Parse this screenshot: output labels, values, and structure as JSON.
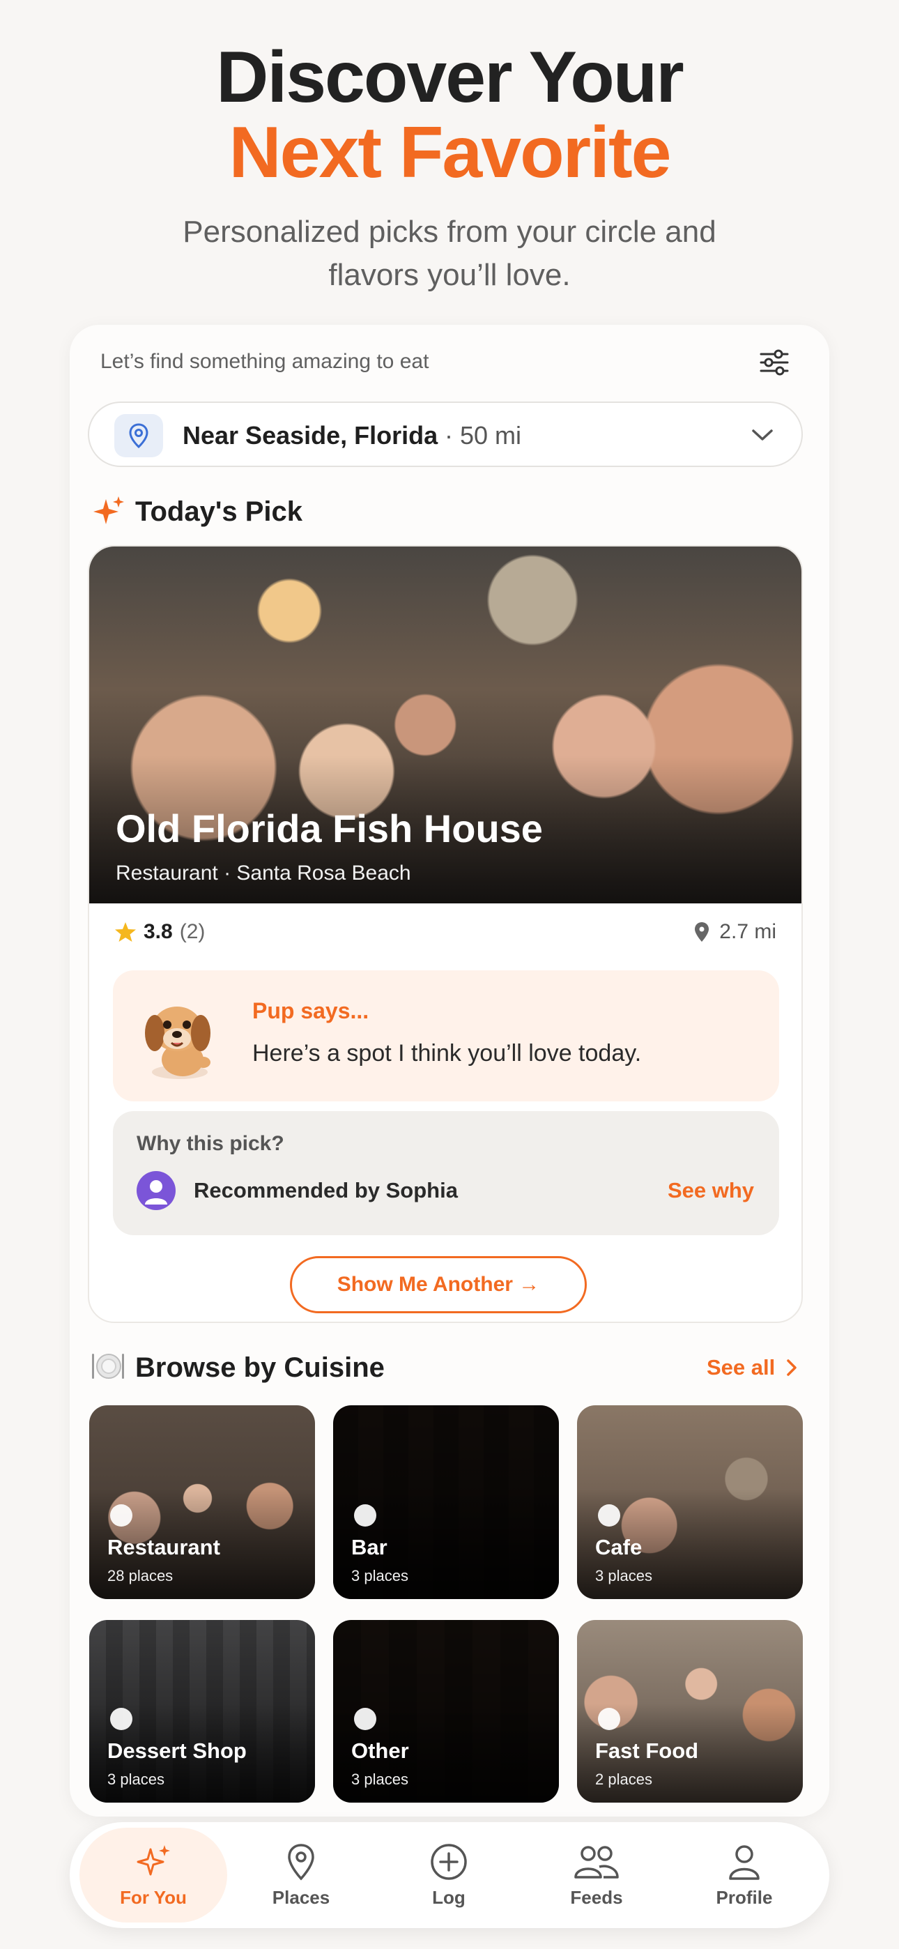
{
  "hero": {
    "title_line1": "Discover Your",
    "title_line2": "Next Favorite",
    "subtitle": "Personalized picks from your circle and flavors you’ll love."
  },
  "finder": {
    "prompt": "Let’s find something amazing to eat",
    "filter_icon": "sliders-icon"
  },
  "location": {
    "name": "Near Seaside, Florida",
    "distance": "· 50 mi",
    "icon": "map-pin-icon"
  },
  "todays_pick": {
    "section_title": "Today's Pick",
    "name": "Old Florida Fish House",
    "meta": "Restaurant · Santa Rosa Beach",
    "rating": "3.8",
    "rating_count": "(2)",
    "distance": "2.7 mi",
    "pup_title": "Pup says...",
    "pup_message": "Here’s a spot I think you’ll love today.",
    "why_title": "Why this pick?",
    "recommended_by": "Recommended by Sophia",
    "see_why": "See why",
    "another_button": "Show Me Another →"
  },
  "browse": {
    "section_title": "Browse by Cuisine",
    "see_all": "See all",
    "tiles": [
      {
        "name": "Restaurant",
        "count": "28 places"
      },
      {
        "name": "Bar",
        "count": "3 places"
      },
      {
        "name": "Cafe",
        "count": "3 places"
      },
      {
        "name": "Dessert Shop",
        "count": "3 places"
      },
      {
        "name": "Other",
        "count": "3 places"
      },
      {
        "name": "Fast Food",
        "count": "2 places"
      }
    ]
  },
  "nav": {
    "items": [
      {
        "label": "For You",
        "icon": "sparkle-icon",
        "active": true
      },
      {
        "label": "Places",
        "icon": "map-pin-icon",
        "active": false
      },
      {
        "label": "Log",
        "icon": "plus-circle-icon",
        "active": false
      },
      {
        "label": "Feeds",
        "icon": "people-icon",
        "active": false
      },
      {
        "label": "Profile",
        "icon": "person-icon",
        "active": false
      }
    ]
  },
  "colors": {
    "accent": "#f26a21",
    "background": "#f8f6f4",
    "pup_bg": "#fff2ea",
    "why_bg": "#f1efec"
  }
}
